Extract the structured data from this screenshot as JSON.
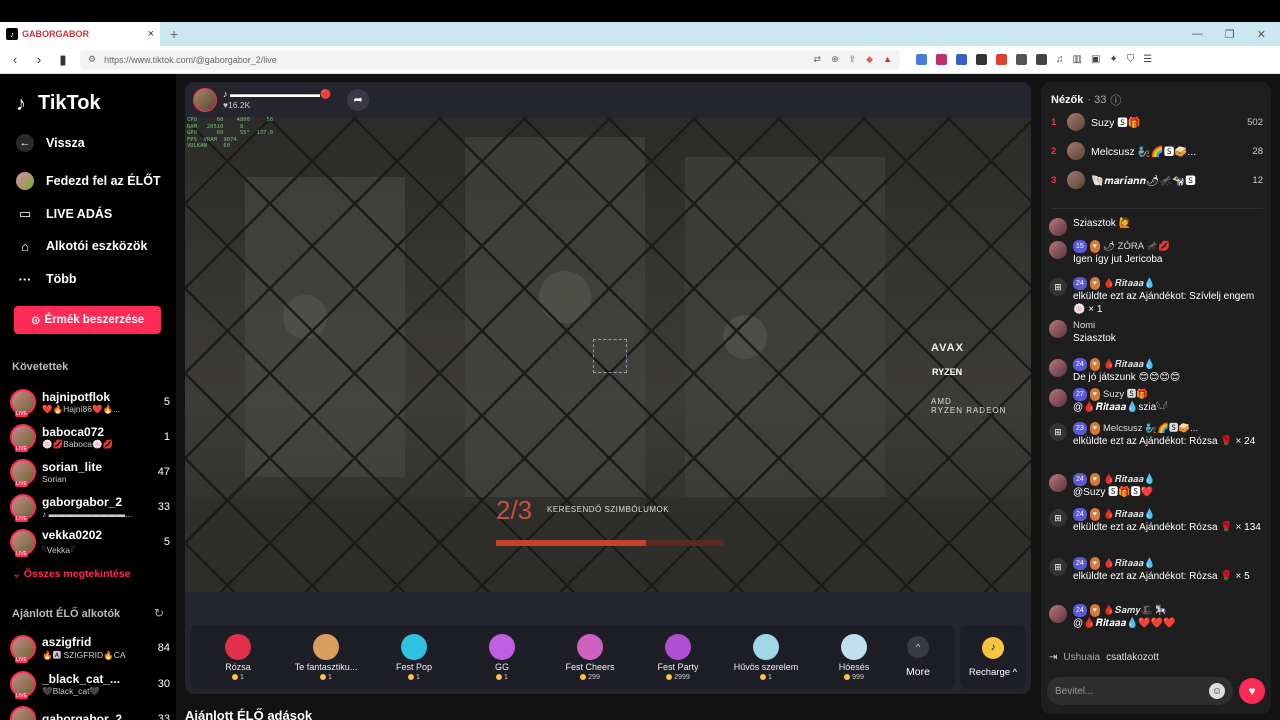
{
  "browser": {
    "tab_title": "GABORGABOR",
    "url": "https://www.tiktok.com/@gaborgabor_2/live",
    "new_tab": "+",
    "tab_close": "×"
  },
  "sidebar": {
    "logo": "TikTok",
    "nav": [
      {
        "label": "Vissza",
        "icon": "arrow-left-icon"
      },
      {
        "label": "Fedezd fel az ÉLŐT",
        "icon": "avatar-icon"
      },
      {
        "label": "LIVE ADÁS",
        "icon": "camera-icon"
      },
      {
        "label": "Alkotói eszközök",
        "icon": "lightbulb-icon"
      },
      {
        "label": "Több",
        "icon": "more-icon"
      }
    ],
    "coin_button": "Érmék beszerzése",
    "following_title": "Követettek",
    "following": [
      {
        "name": "hajnipotflok",
        "sub": "❤️🔥Hajni86❤️🔥...",
        "count": "5"
      },
      {
        "name": "baboca072",
        "sub": "🍥💋Baboca🍥💋",
        "count": "1"
      },
      {
        "name": "sorian_lite",
        "sub": "Sorian",
        "count": "47"
      },
      {
        "name": "gaborgabor_2",
        "sub": "♪ ▬▬▬▬▬▬▬▬▬...",
        "count": "33"
      },
      {
        "name": "vekka0202",
        "sub": "𓆩Vekka𓆪",
        "count": "5"
      }
    ],
    "see_all": "Összes megtekintése",
    "suggested_title": "Ajánlott ÉLŐ alkotók",
    "suggested": [
      {
        "name": "aszigfrid",
        "sub": "🔥🅰 SZIGFRID🔥CA",
        "count": "84"
      },
      {
        "name": "_black_cat_...",
        "sub": "🖤Black_cat🖤",
        "count": "30"
      },
      {
        "name": "gaborgabor_2",
        "sub": "",
        "count": "33"
      }
    ]
  },
  "stream": {
    "host_name": "♪ ▬▬▬▬▬▬▬▬▬▬🔴",
    "viewers": "16.2K",
    "perf_overlay": "CPU      60    4800     58\nRAM   20510     8\nGPU      60     55°  137.0\nFPS  VRAM  9074\nVULKAN     60",
    "brand": "AVAX",
    "brand_ryzen": "RYZEN",
    "brand_amd": "AMD\nRYZEN RADEON",
    "objective_counter": "2/3",
    "objective_label": "KERESENDŐ SZIMBÓLUMOK",
    "objective_progress": 0.66,
    "gifts": [
      {
        "name": "Rózsa",
        "price": "1",
        "color": "#e0304a"
      },
      {
        "name": "Te fantasztiku...",
        "price": "1",
        "color": "#d8a060"
      },
      {
        "name": "Fest Pop",
        "price": "1",
        "color": "#30c0e0"
      },
      {
        "name": "GG",
        "price": "1",
        "color": "#c060e0"
      },
      {
        "name": "Fest Cheers",
        "price": "299",
        "color": "#d060c0"
      },
      {
        "name": "Fest Party",
        "price": "2999",
        "color": "#b050d0"
      },
      {
        "name": "Hűvös szerelem",
        "price": "1",
        "color": "#a0d8e8"
      },
      {
        "name": "Hóesés",
        "price": "999",
        "color": "#c0e0f0"
      }
    ],
    "more_label": "More",
    "recharge_label": "Recharge"
  },
  "recommended_heading": "Ajánlott ÉLŐ adások",
  "viewers_panel": {
    "title": "Nézők",
    "count": "· 33",
    "top": [
      {
        "rank": "1",
        "name": "Suzy 🆂🎁",
        "score": "502"
      },
      {
        "rank": "2",
        "name": "Melcsusz 🧞🌈🆂🥪...",
        "score": "28"
      },
      {
        "rank": "3",
        "name": "🐚𝒎𝒂𝒓𝒊𝒂𝒏𝒏🌶🦟🐄🆂",
        "score": "12"
      }
    ]
  },
  "chat": [
    {
      "user": "",
      "badges": "",
      "msg": "Sziasztok 🙋",
      "type": "msg"
    },
    {
      "user": "🌶 ZÓRA 🦟💋",
      "badges": "15",
      "msg": "Igen így jut Jericoba",
      "type": "msg"
    },
    {
      "user": "🩸𝑹𝒊𝒕𝒂𝒂𝒂💧",
      "badges": "24",
      "msg": "elküldte ezt az Ajándékot: Szívlelj engem 🍥 × 1",
      "type": "gift"
    },
    {
      "user": "Nomi",
      "badges": "",
      "msg": "Sziasztok",
      "type": "msg"
    },
    {
      "user": "🩸𝑹𝒊𝒕𝒂𝒂𝒂💧",
      "badges": "24",
      "msg": "De jó játszunk 😊😊😊😊",
      "type": "msg"
    },
    {
      "user": "Suzy 🆂🎁",
      "badges": "27",
      "msg": "@🩸𝑹𝒊𝒕𝒂𝒂𝒂💧szia𓆩𓆪",
      "type": "msg"
    },
    {
      "user": "Melcsusz 🧞🌈🆂🥪...",
      "badges": "23",
      "msg": "elküldte ezt az Ajándékot: Rózsa 🌹 × 24",
      "type": "gift"
    },
    {
      "user": "🩸𝑹𝒊𝒕𝒂𝒂𝒂💧",
      "badges": "24",
      "msg": "@Suzy 🆂🎁🆂❤️",
      "type": "msg"
    },
    {
      "user": "🩸𝑹𝒊𝒕𝒂𝒂𝒂💧",
      "badges": "24",
      "msg": "elküldte ezt az Ajándékot: Rózsa 🌹 × 134",
      "type": "gift"
    },
    {
      "user": "🩸𝑹𝒊𝒕𝒂𝒂𝒂💧",
      "badges": "24",
      "msg": "elküldte ezt az Ajándékot: Rózsa 🌹 × 5",
      "type": "gift"
    },
    {
      "user": "🩸𝑺𝒂𝒎𝒚🎩 🎠",
      "badges": "24",
      "msg": "@🩸𝑹𝒊𝒕𝒂𝒂𝒂💧❤️❤️❤️",
      "type": "msg"
    }
  ],
  "joined": {
    "user": "Ushuaia",
    "text": "csatlakozott"
  },
  "chat_input_placeholder": "Bevitel..."
}
